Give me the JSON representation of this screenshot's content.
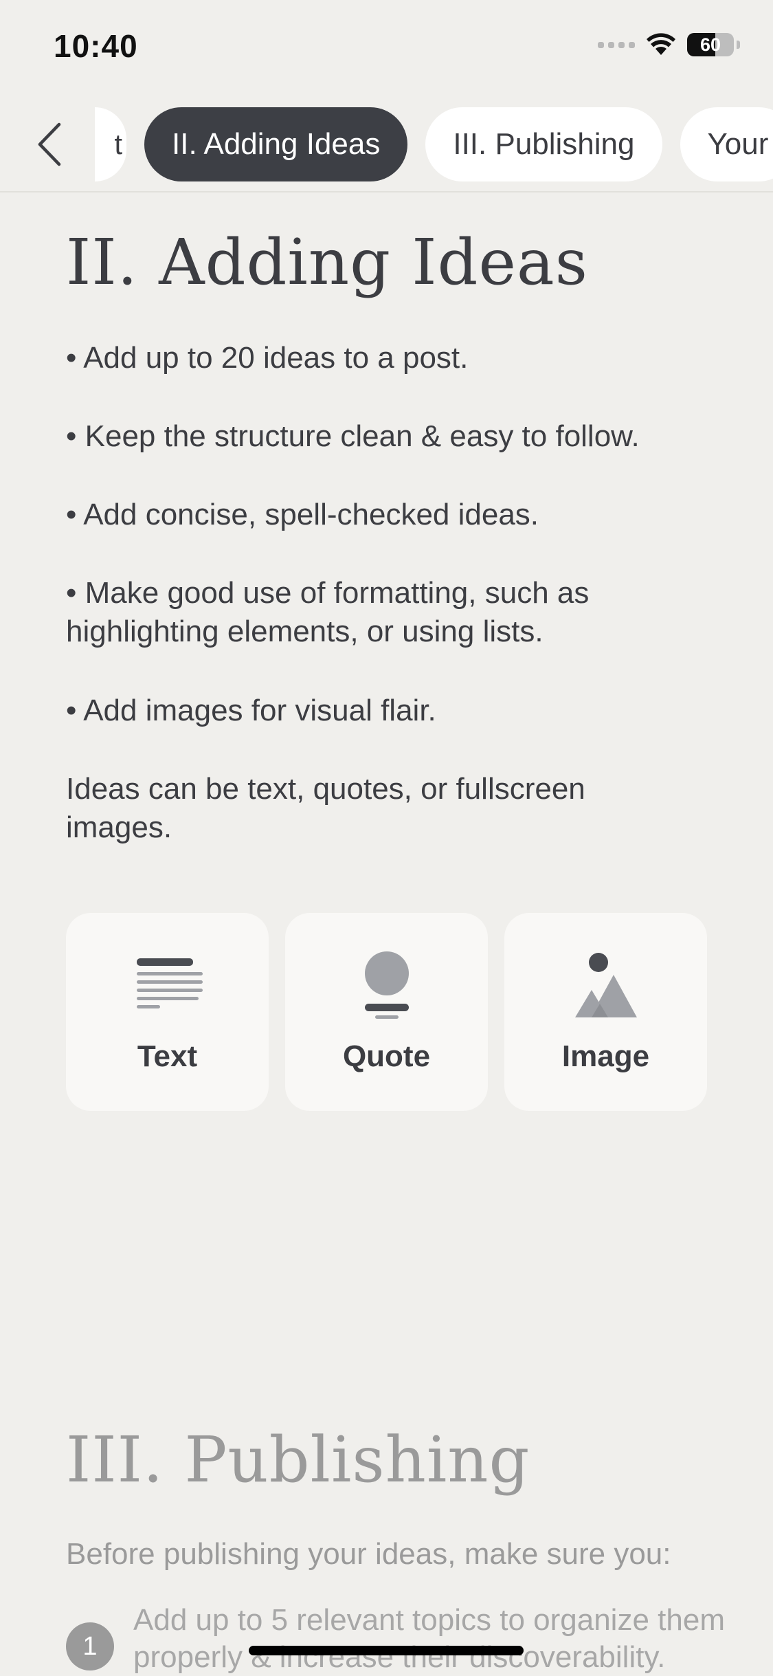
{
  "status_bar": {
    "time": "10:40",
    "battery": "60"
  },
  "tabs": {
    "partial_label": "t",
    "items": [
      {
        "label": "II. Adding Ideas",
        "active": true
      },
      {
        "label": "III. Publishing",
        "active": false
      },
      {
        "label": "Your",
        "active": false
      }
    ]
  },
  "section_adding": {
    "title": "II. Adding Ideas",
    "bullets": [
      "• Add up to 20 ideas to a post.",
      "• Keep the structure clean & easy to follow.",
      "• Add concise, spell-checked ideas.",
      "• Make good use of formatting, such as highlighting elements, or using lists.",
      "• Add images for visual flair."
    ],
    "summary": "Ideas can be text, quotes, or fullscreen images.",
    "idea_types": [
      {
        "label": "Text",
        "icon": "text-lines-icon"
      },
      {
        "label": "Quote",
        "icon": "quote-person-icon"
      },
      {
        "label": "Image",
        "icon": "mountain-image-icon"
      }
    ]
  },
  "section_publishing": {
    "title": "III. Publishing",
    "intro": "Before publishing your ideas, make sure you:",
    "items": [
      {
        "number": "1",
        "text": "Add up to 5 relevant topics to organize them properly & increase their discoverability."
      }
    ]
  },
  "colors": {
    "background": "#f0efec",
    "active_tab": "#3d3f45",
    "text": "#3c3d42",
    "muted": "#9a9a9a",
    "card": "#f9f8f6"
  }
}
